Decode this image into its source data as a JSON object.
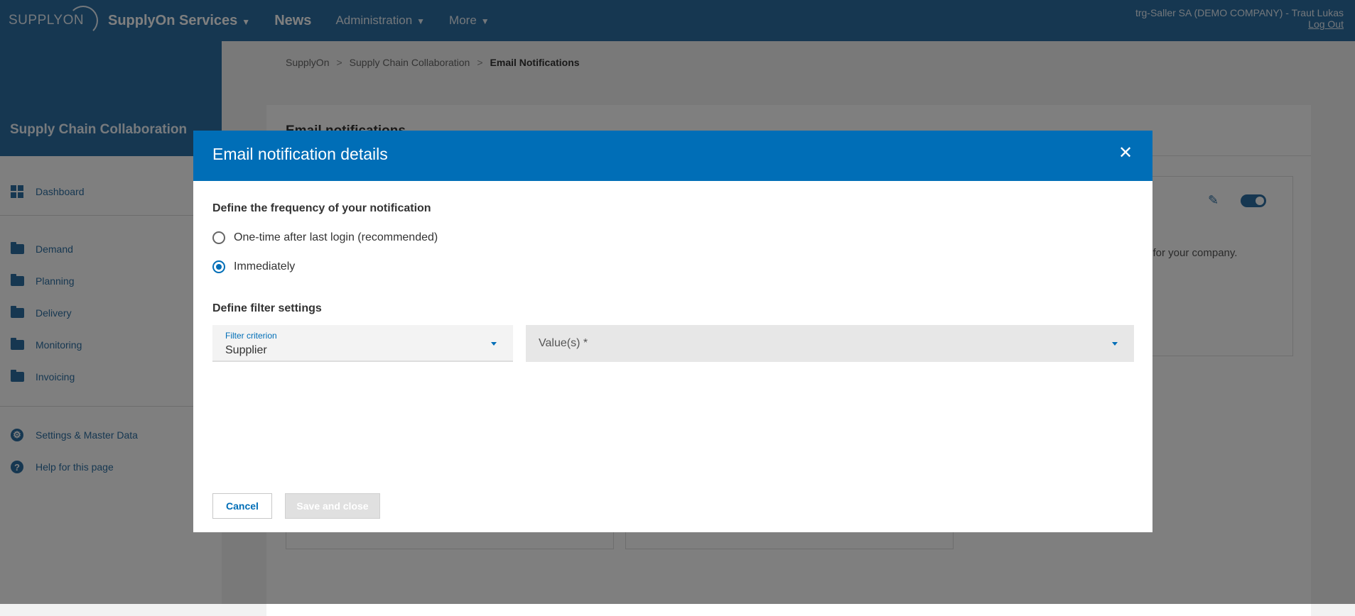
{
  "topbar": {
    "logo": "SUPPLYON",
    "nav": {
      "services": "SupplyOn Services",
      "news": "News",
      "administration": "Administration",
      "more": "More"
    },
    "user": "trg-Saller SA (DEMO COMPANY) - Traut Lukas",
    "logout": "Log Out"
  },
  "sidebar": {
    "title": "Supply Chain Collaboration",
    "dashboard": "Dashboard",
    "items": [
      "Demand",
      "Planning",
      "Delivery",
      "Monitoring",
      "Invoicing"
    ],
    "settings": "Settings & Master Data",
    "help": "Help for this page"
  },
  "breadcrumb": [
    "SupplyOn",
    "Supply Chain Collaboration",
    "Email Notifications"
  ],
  "page": {
    "card_title": "Email notifications",
    "bg_text": "d for your company."
  },
  "modal": {
    "title": "Email notification details",
    "frequency_title": "Define the frequency of your notification",
    "options": [
      "One-time after last login (recommended)",
      "Immediately"
    ],
    "selected_option": "Immediately",
    "filter_title": "Define filter settings",
    "filter_criterion_label": "Filter criterion",
    "filter_criterion_value": "Supplier",
    "values_placeholder": "Value(s) *",
    "cancel": "Cancel",
    "save": "Save and close"
  },
  "colors": {
    "brand": "#006eb7",
    "topbar": "#2d6fa3"
  }
}
